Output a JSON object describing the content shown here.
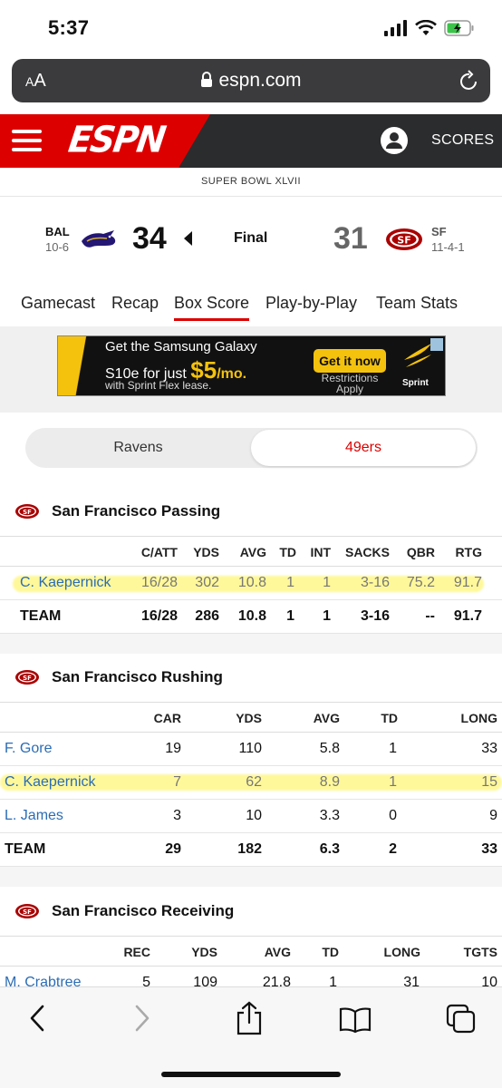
{
  "status": {
    "time": "5:37"
  },
  "browser": {
    "aa": "AA",
    "url": "espn.com"
  },
  "header": {
    "logo": "ESPN",
    "scores_label": "SCORES"
  },
  "game": {
    "event": "SUPER BOWL XLVII",
    "away": {
      "abbr": "BAL",
      "record": "10-6",
      "score": "34",
      "color": "#241773"
    },
    "status": "Final",
    "home": {
      "abbr": "SF",
      "record": "11-4-1",
      "score": "31",
      "color": "#aa0000"
    }
  },
  "tabs": [
    "Gamecast",
    "Recap",
    "Box Score",
    "Play-by-Play",
    "Team Stats"
  ],
  "active_tab": "Box Score",
  "ad": {
    "line1": "Get the Samsung Galaxy",
    "line2_prefix": "S10e for just ",
    "line2_price": "$5",
    "line2_suffix": "/mo.",
    "line3": "with Sprint Flex lease.",
    "cta": "Get it now",
    "restrictions": "Restrictions Apply",
    "brand": "Sprint"
  },
  "team_toggle": {
    "left": "Ravens",
    "right": "49ers"
  },
  "passing": {
    "title": "San Francisco Passing",
    "headers": [
      "C/ATT",
      "YDS",
      "AVG",
      "TD",
      "INT",
      "SACKS",
      "QBR",
      "RTG"
    ],
    "rows": [
      {
        "name": "C. Kaepernick",
        "cells": [
          "16/28",
          "302",
          "10.8",
          "1",
          "1",
          "3-16",
          "75.2",
          "91.7"
        ]
      }
    ],
    "team": {
      "name": "TEAM",
      "cells": [
        "16/28",
        "286",
        "10.8",
        "1",
        "1",
        "3-16",
        "--",
        "91.7"
      ]
    }
  },
  "rushing": {
    "title": "San Francisco Rushing",
    "headers": [
      "CAR",
      "YDS",
      "AVG",
      "TD",
      "LONG"
    ],
    "rows": [
      {
        "name": "F. Gore",
        "cells": [
          "19",
          "110",
          "5.8",
          "1",
          "33"
        ]
      },
      {
        "name": "C. Kaepernick",
        "cells": [
          "7",
          "62",
          "8.9",
          "1",
          "15"
        ]
      },
      {
        "name": "L. James",
        "cells": [
          "3",
          "10",
          "3.3",
          "0",
          "9"
        ]
      }
    ],
    "team": {
      "name": "TEAM",
      "cells": [
        "29",
        "182",
        "6.3",
        "2",
        "33"
      ]
    }
  },
  "receiving": {
    "title": "San Francisco Receiving",
    "headers": [
      "REC",
      "YDS",
      "AVG",
      "TD",
      "LONG",
      "TGTS"
    ],
    "rows": [
      {
        "name": "M. Crabtree",
        "cells": [
          "5",
          "109",
          "21.8",
          "1",
          "31",
          "10"
        ]
      }
    ]
  },
  "colors": {
    "espn_red": "#dd0000",
    "link_blue": "#2b6cb5",
    "highlight": "#fff578"
  }
}
